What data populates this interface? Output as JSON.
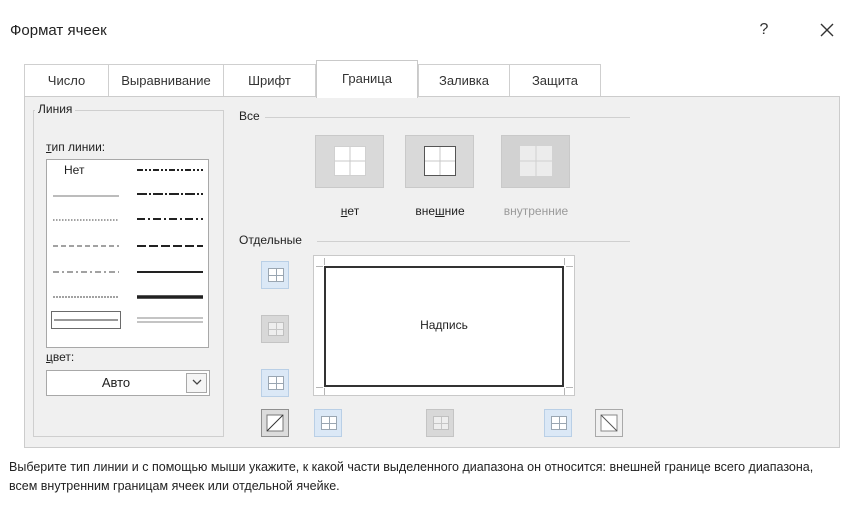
{
  "window": {
    "title": "Формат ячеек",
    "help_label": "?",
    "close_icon": "close-icon"
  },
  "tabs": [
    {
      "label": "Число"
    },
    {
      "label": "Выравнивание"
    },
    {
      "label": "Шрифт"
    },
    {
      "label": "Граница",
      "active": true
    },
    {
      "label": "Заливка"
    },
    {
      "label": "Защита"
    }
  ],
  "line_group": {
    "title": "Линия",
    "type_label_first": "т",
    "type_label_rest": "ип линии:",
    "none_option": "Нет",
    "color_label_first": "ц",
    "color_label_rest": "вет:",
    "color_value": "Авто"
  },
  "presets": {
    "title": "Все",
    "none_first": "н",
    "none_rest": "ет",
    "outline_pre": "вне",
    "outline_u": "ш",
    "outline_post": "ние",
    "inside_label": "внутренние"
  },
  "border_group": {
    "title": "Отдельные",
    "preview_text": "Надпись"
  },
  "hint": "Выберите тип линии и с помощью мыши укажите, к какой части выделенного диапазона он относится: внешней границе всего диапазона, всем внутренним границам ячеек или отдельной ячейке.",
  "colors": {
    "panel_bg": "#f0f0f0",
    "active_button": "#dbe8f6",
    "preset_bg": "#d9d9d9"
  }
}
